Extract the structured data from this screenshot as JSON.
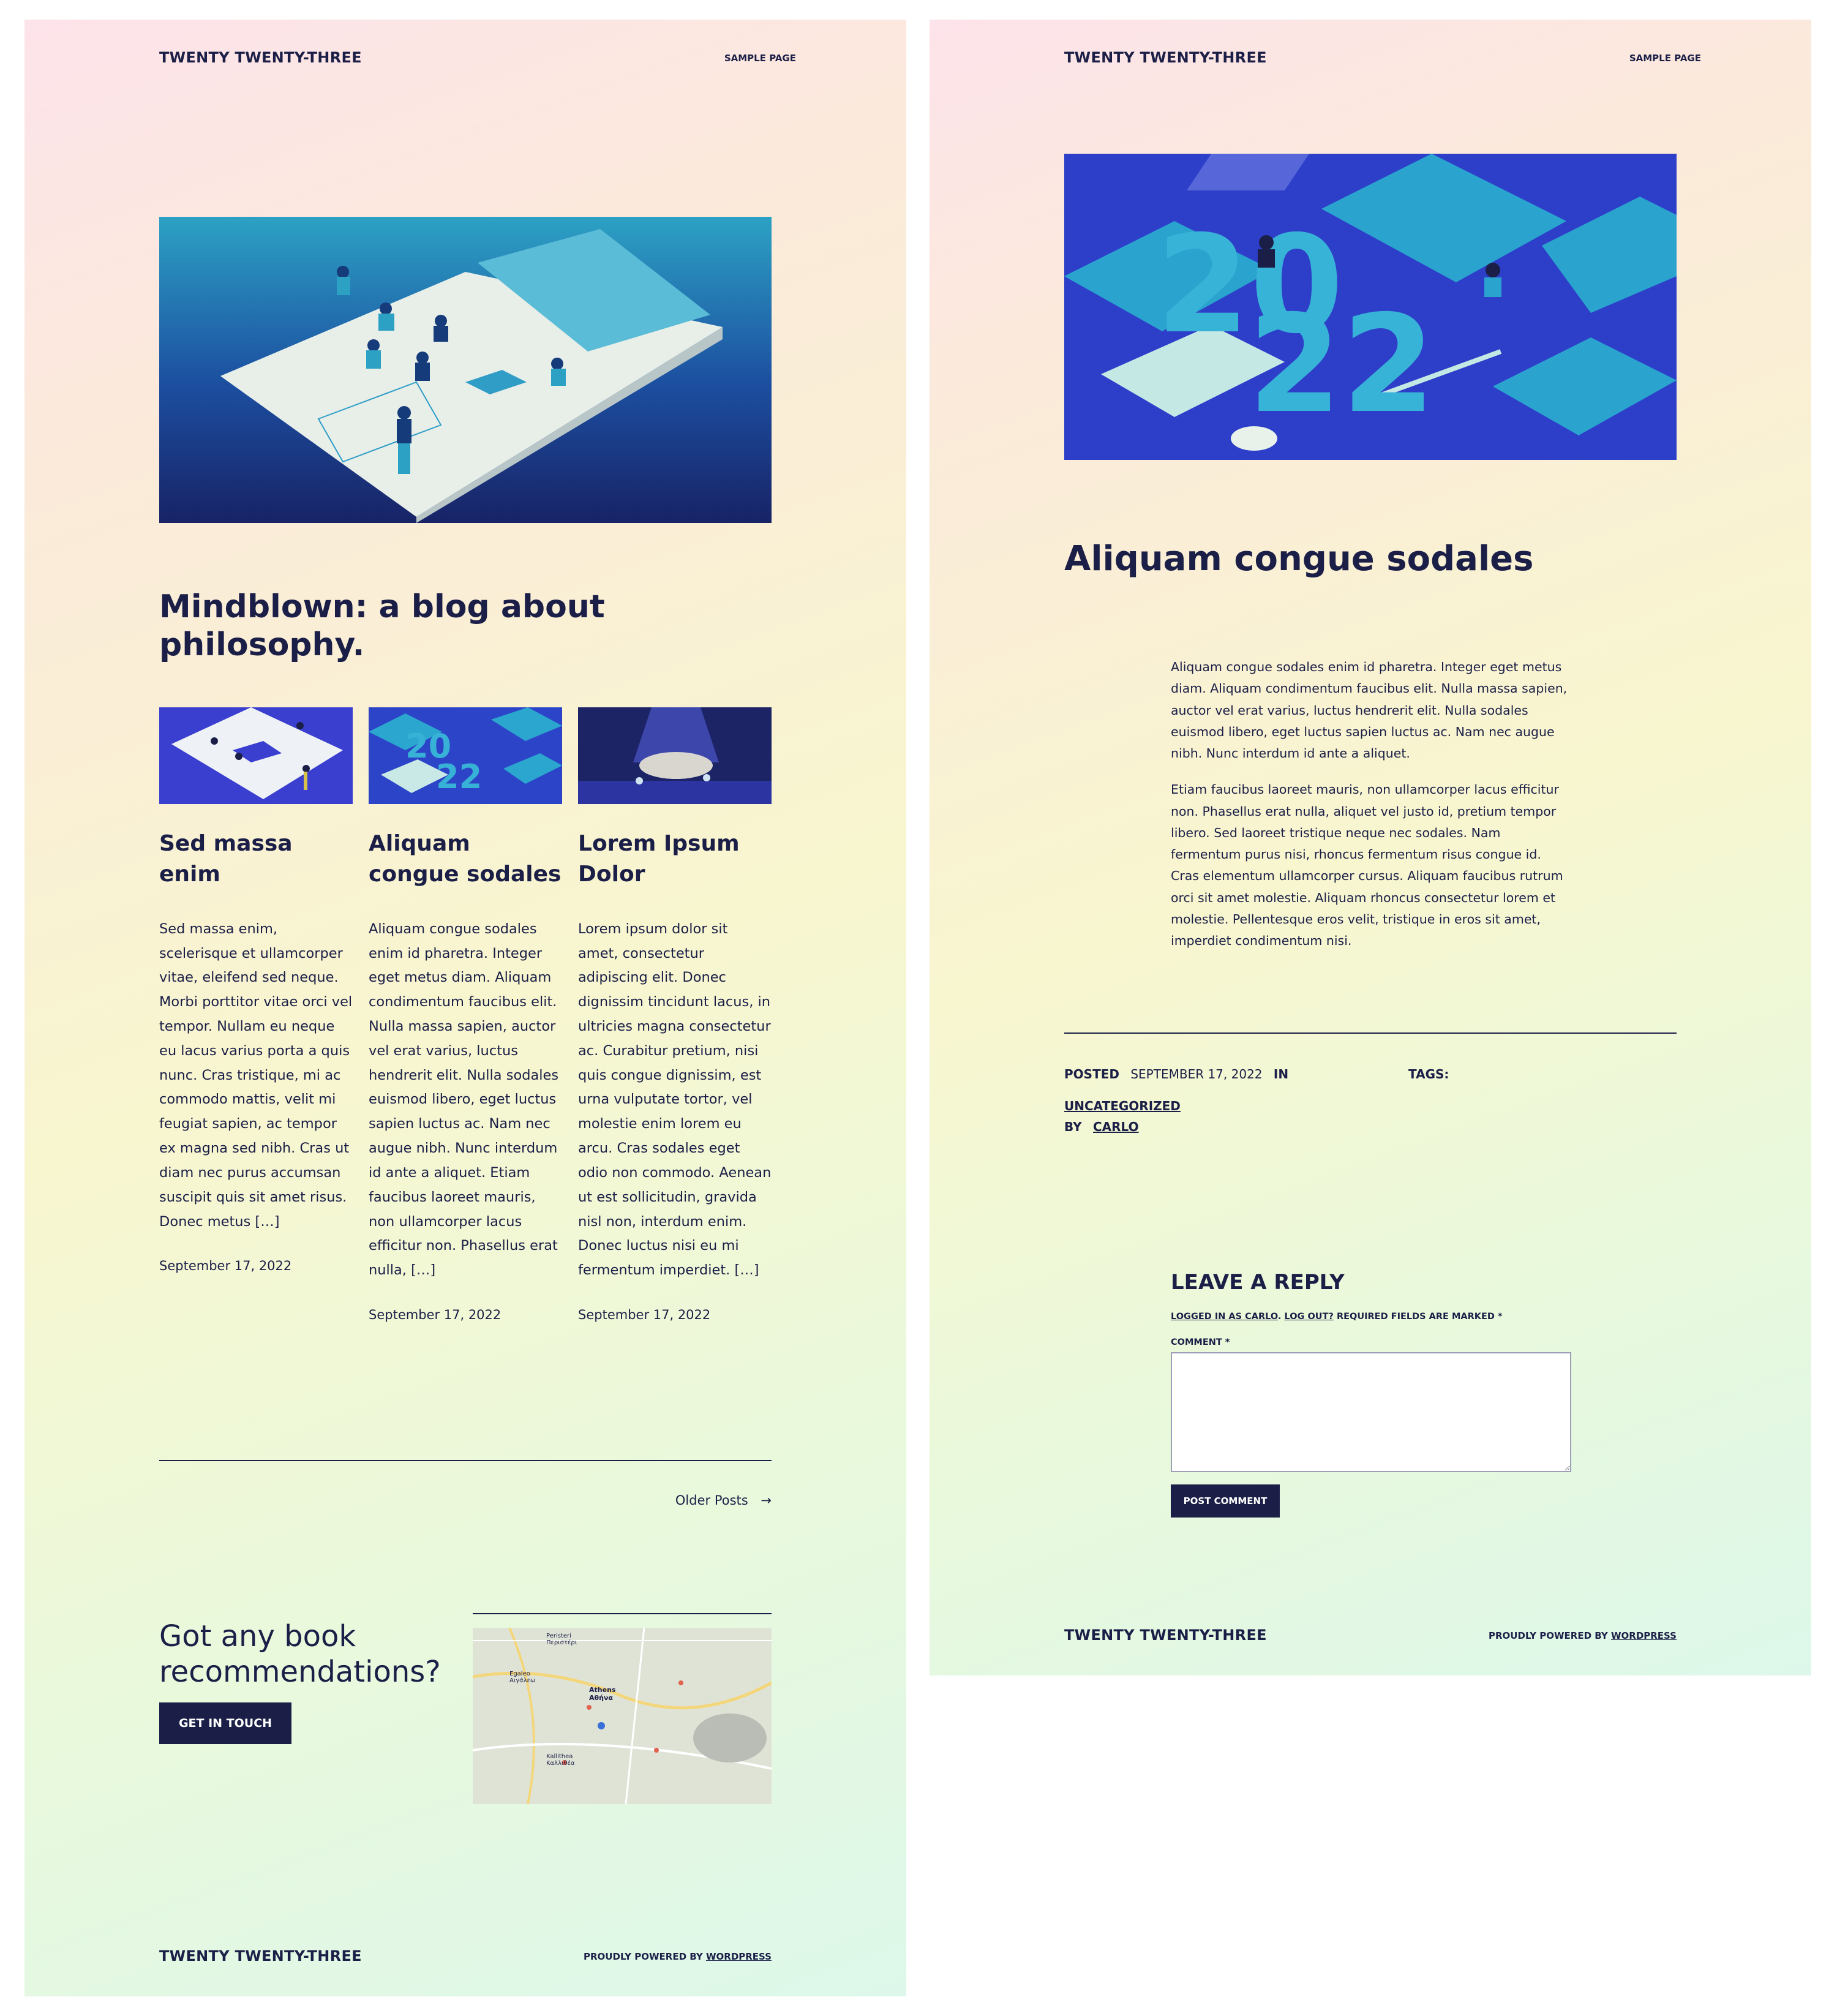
{
  "site": {
    "title": "TWENTY TWENTY-THREE",
    "nav_sample_page": "SAMPLE PAGE",
    "footer_powered_prefix": "PROUDLY POWERED BY",
    "footer_powered_link": "WORDPRESS"
  },
  "home": {
    "heading": "Mindblown: a blog about philosophy.",
    "posts": [
      {
        "title": "Sed massa enim",
        "excerpt": "Sed massa enim, scelerisque et ullamcorper vitae, eleifend sed neque. Morbi porttitor vitae orci vel tempor. Nullam eu neque eu lacus varius porta a quis nunc. Cras tristique, mi ac commodo mattis, velit mi feugiat sapien, ac tempor ex magna sed nibh. Cras ut diam nec purus accumsan suscipit quis sit amet risus. Donec metus […]",
        "date": "September 17, 2022"
      },
      {
        "title": "Aliquam congue sodales",
        "excerpt": "Aliquam congue sodales enim id pharetra. Integer eget metus diam. Aliquam condimentum faucibus elit. Nulla massa sapien, auctor vel erat varius, luctus hendrerit elit. Nulla sodales euismod libero, eget luctus sapien luctus ac. Nam nec augue nibh. Nunc interdum id ante a aliquet. Etiam faucibus laoreet mauris, non ullamcorper lacus efficitur non. Phasellus erat nulla, […]",
        "date": "September 17, 2022"
      },
      {
        "title": "Lorem Ipsum Dolor",
        "excerpt": "Lorem ipsum dolor sit amet, consectetur adipiscing elit. Donec dignissim tincidunt lacus, in ultricies magna consectetur ac. Curabitur pretium, nisi quis congue dignissim, est urna vulputate tortor, vel molestie enim lorem eu arcu. Cras sodales eget odio non commodo. Aenean ut est sollicitudin, gravida nisl non, interdum enim. Donec luctus nisi eu mi fermentum imperdiet. […]",
        "date": "September 17, 2022"
      }
    ],
    "older_posts": "Older Posts",
    "older_arrow": "→",
    "cta_heading": "Got any book recommendations?",
    "cta_button": "GET IN TOUCH",
    "map_labels": [
      "Athens",
      "Αθήνα",
      "Kallithea",
      "Καλλιθέα",
      "Peristeri",
      "Περιστέρι",
      "Egaleo",
      "Αιγάλεω"
    ]
  },
  "single": {
    "title": "Aliquam congue sodales",
    "paragraphs": [
      "Aliquam congue sodales enim id pharetra. Integer eget metus diam. Aliquam condimentum faucibus elit. Nulla massa sapien, auctor vel erat varius, luctus hendrerit elit. Nulla sodales euismod libero, eget luctus sapien luctus ac. Nam nec augue nibh. Nunc interdum id ante a aliquet.",
      "Etiam faucibus laoreet mauris, non ullamcorper lacus efficitur non. Phasellus erat nulla, aliquet vel justo id, pretium tempor libero. Sed laoreet tristique neque nec sodales. Nam fermentum purus nisi, rhoncus fermentum risus congue id. Cras elementum ullamcorper cursus. Aliquam faucibus rutrum orci sit amet molestie. Aliquam rhoncus consectetur lorem et molestie. Pellentesque eros velit, tristique in eros sit amet, imperdiet condimentum nisi."
    ],
    "meta": {
      "posted_label": "POSTED",
      "date": "SEPTEMBER 17, 2022",
      "in_label": "IN",
      "category": "UNCATEGORIZED",
      "by_label": "BY",
      "author": "CARLO",
      "tags_label": "TAGS:"
    },
    "reply": {
      "heading": "LEAVE A REPLY",
      "logged_in": "LOGGED IN AS CARLO",
      "log_out": "LOG OUT?",
      "required_note": "REQUIRED FIELDS ARE MARKED *",
      "comment_label": "COMMENT *",
      "comment_value": "",
      "submit": "POST COMMENT"
    }
  },
  "colors": {
    "ink": "#1b1f47",
    "gradient_top": "#fde3ea",
    "gradient_mid": "#f8f6cf",
    "gradient_bottom": "#ddf8ea"
  }
}
